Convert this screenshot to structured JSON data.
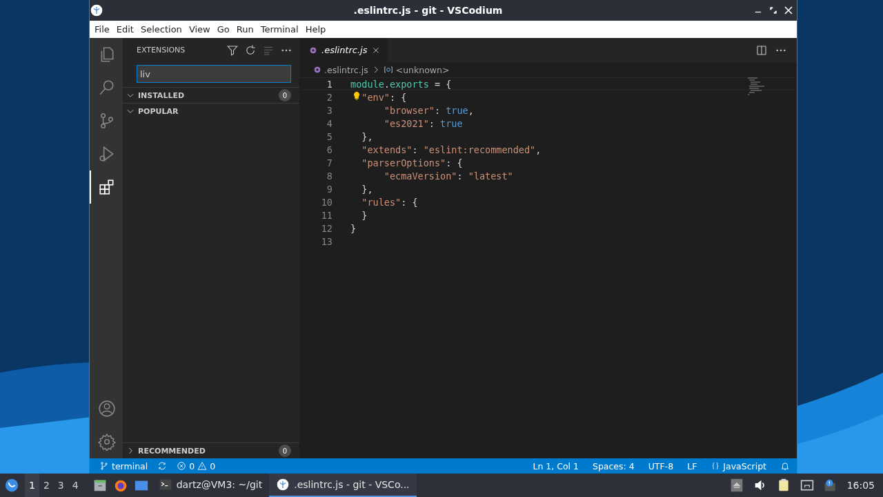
{
  "window": {
    "title": ".eslintrc.js - git - VSCodium"
  },
  "menu": [
    "File",
    "Edit",
    "Selection",
    "View",
    "Go",
    "Run",
    "Terminal",
    "Help"
  ],
  "activity_bar": [
    {
      "kind": "files",
      "selected": false
    },
    {
      "kind": "search",
      "selected": false
    },
    {
      "kind": "source-control",
      "selected": false
    },
    {
      "kind": "run",
      "selected": false
    },
    {
      "kind": "extensions",
      "selected": true
    },
    {
      "kind": "account",
      "selected": false
    },
    {
      "kind": "settings",
      "selected": false
    }
  ],
  "sidebar": {
    "title": "EXTENSIONS",
    "search": {
      "value": "liv"
    },
    "sections": [
      {
        "label": "INSTALLED",
        "count": "0",
        "expanded": true
      },
      {
        "label": "POPULAR",
        "expanded": true
      },
      {
        "label": "RECOMMENDED",
        "count": "0",
        "expanded": false
      }
    ]
  },
  "tabs": [
    {
      "label": ".eslintrc.js",
      "selected": true
    }
  ],
  "breadcrumbs": [
    ".eslintrc.js",
    "<unknown>"
  ],
  "editor": {
    "lines": [
      {
        "number": "1",
        "tokens": [
          {
            "kind": "ident",
            "text": "module"
          },
          {
            "kind": "punct",
            "text": "."
          },
          {
            "kind": "ident",
            "text": "exports"
          },
          {
            "kind": "punct",
            "text": " = {"
          }
        ]
      },
      {
        "number": "2",
        "tokens": [
          {
            "kind": "string",
            "text": "  \"env\""
          },
          {
            "kind": "punct",
            "text": ": {"
          }
        ]
      },
      {
        "number": "3",
        "tokens": [
          {
            "kind": "string",
            "text": "      \"browser\""
          },
          {
            "kind": "punct",
            "text": ": "
          },
          {
            "kind": "bool",
            "text": "true"
          },
          {
            "kind": "punct",
            "text": ","
          }
        ]
      },
      {
        "number": "4",
        "tokens": [
          {
            "kind": "string",
            "text": "      \"es2021\""
          },
          {
            "kind": "punct",
            "text": ": "
          },
          {
            "kind": "bool",
            "text": "true"
          }
        ]
      },
      {
        "number": "5",
        "tokens": [
          {
            "kind": "punct",
            "text": "  },"
          }
        ]
      },
      {
        "number": "6",
        "tokens": [
          {
            "kind": "string",
            "text": "  \"extends\""
          },
          {
            "kind": "punct",
            "text": ": "
          },
          {
            "kind": "string",
            "text": "\"eslint:recommended\""
          },
          {
            "kind": "punct",
            "text": ","
          }
        ]
      },
      {
        "number": "7",
        "tokens": [
          {
            "kind": "string",
            "text": "  \"parserOptions\""
          },
          {
            "kind": "punct",
            "text": ": {"
          }
        ]
      },
      {
        "number": "8",
        "tokens": [
          {
            "kind": "string",
            "text": "      \"ecmaVersion\""
          },
          {
            "kind": "punct",
            "text": ": "
          },
          {
            "kind": "string",
            "text": "\"latest\""
          }
        ]
      },
      {
        "number": "9",
        "tokens": [
          {
            "kind": "punct",
            "text": "  },"
          }
        ]
      },
      {
        "number": "10",
        "tokens": [
          {
            "kind": "string",
            "text": "  \"rules\""
          },
          {
            "kind": "punct",
            "text": ": {"
          }
        ]
      },
      {
        "number": "11",
        "tokens": [
          {
            "kind": "punct",
            "text": "  }"
          }
        ]
      },
      {
        "number": "12",
        "tokens": [
          {
            "kind": "punct",
            "text": "}"
          }
        ]
      },
      {
        "number": "13"
      }
    ]
  },
  "status_bar": {
    "branch": "terminal",
    "errors": "0",
    "warnings": "0",
    "right": [
      "Ln 1, Col 1",
      "Spaces: 4",
      "UTF-8",
      "LF"
    ],
    "language": "JavaScript"
  },
  "taskbar": {
    "workspaces": [
      {
        "label": "1",
        "selected": true
      },
      {
        "label": "2",
        "selected": false
      },
      {
        "label": "3",
        "selected": false
      },
      {
        "label": "4",
        "selected": false
      }
    ],
    "tasks": [
      {
        "kind": "terminal",
        "label": "dartz@VM3: ~/git",
        "selected": false
      },
      {
        "kind": "editor",
        "label": ".eslintrc.js - git - VSCo...",
        "selected": true
      }
    ],
    "clock": "16:05"
  }
}
